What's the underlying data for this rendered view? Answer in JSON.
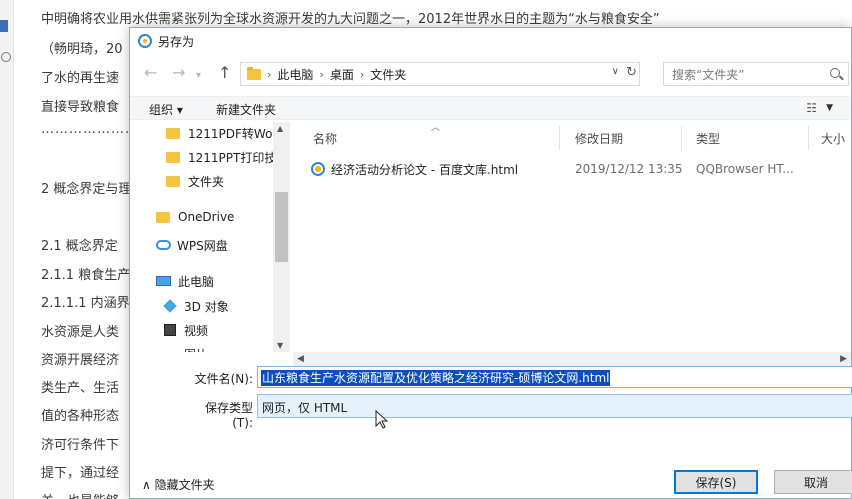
{
  "background_document": {
    "lines": [
      "中明确将农业用水供需紧张列为全球水资源开发的九大问题之一，2012年世界水日的主题为“水与粮食安全”",
      "（畅明琦，20",
      "了水的再生速",
      "直接导致粮食",
      "……………………",
      "2 概念界定与理",
      "2.1 概念界定",
      "2.1.1 粮食生产",
      "2.1.1.1 内涵界",
      "水资源是人类",
      "资源开展经济",
      "类生产、生活",
      "值的各种形态",
      "济可行条件下",
      "提下，通过经",
      "关，也是能够"
    ]
  },
  "dialog": {
    "title": "另存为",
    "address": {
      "crumbs": [
        "此电脑",
        "桌面",
        "文件夹"
      ]
    },
    "search_placeholder": "搜索“文件夹”",
    "toolbar": {
      "organize": "组织 ▾",
      "new_folder": "新建文件夹"
    },
    "nav_items": [
      "1211PDF转Wor",
      "1211PPT打印技",
      "文件夹",
      "OneDrive",
      "WPS网盘",
      "此电脑",
      "3D 对象",
      "视频",
      "图片"
    ],
    "columns": {
      "name": "名称",
      "date": "修改日期",
      "type": "类型",
      "size": "大小"
    },
    "files": [
      {
        "name": "经济活动分析论文 - 百度文库.html",
        "date": "2019/12/12 13:35",
        "type": "QQBrowser HT..."
      }
    ],
    "filename_label": "文件名(N):",
    "filename_value": "山东粮食生产水资源配置及优化策略之经济研究-硕博论文网.html",
    "filetype_label": "保存类型(T):",
    "filetype_value": "网页，仅 HTML",
    "hide_folders": "隐藏文件夹",
    "save_label": "保存(S)",
    "cancel_label": "取消"
  }
}
